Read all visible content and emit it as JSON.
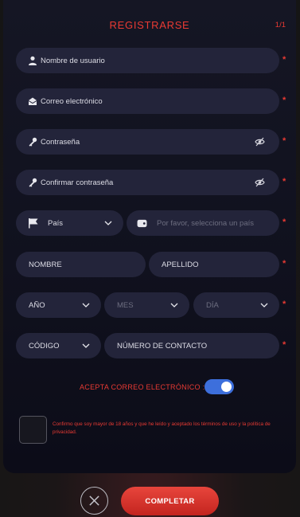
{
  "form": {
    "title": "REGISTRARSE",
    "step": "1/1",
    "required_mark": "*",
    "username": {
      "placeholder": "Nombre de usuario",
      "icon": "user-icon"
    },
    "email": {
      "placeholder": "Correo electrónico",
      "icon": "envelope-icon"
    },
    "password": {
      "placeholder": "Contraseña",
      "icon": "key-icon"
    },
    "confirm_password": {
      "placeholder": "Confirmar contraseña",
      "icon": "key-icon"
    },
    "country": {
      "label": "País",
      "icon": "flag-icon"
    },
    "phone_country": {
      "placeholder": "Por favor, selecciona un país",
      "icon": "phone-card-icon"
    },
    "first_name": {
      "placeholder": "NOMBRE"
    },
    "last_name": {
      "placeholder": "APELLIDO"
    },
    "year": {
      "label": "AÑO"
    },
    "month": {
      "label": "MES"
    },
    "day": {
      "label": "DÍA"
    },
    "code": {
      "label": "CÓDIGO"
    },
    "contact_number": {
      "placeholder": "NÚMERO DE CONTACTO"
    },
    "accept_email_label": "ACEPTA CORREO ELECTRÓNICO :",
    "accept_email_on": true,
    "consent_text": "Confirmo que soy mayor de 18 años y que he leído y aceptado los términos de uso y la política de privacidad.",
    "complete_label": "COMPLETAR"
  },
  "colors": {
    "accent": "#e93a33",
    "field_bg": "#23243a",
    "toggle_on": "#3d6fdc"
  }
}
